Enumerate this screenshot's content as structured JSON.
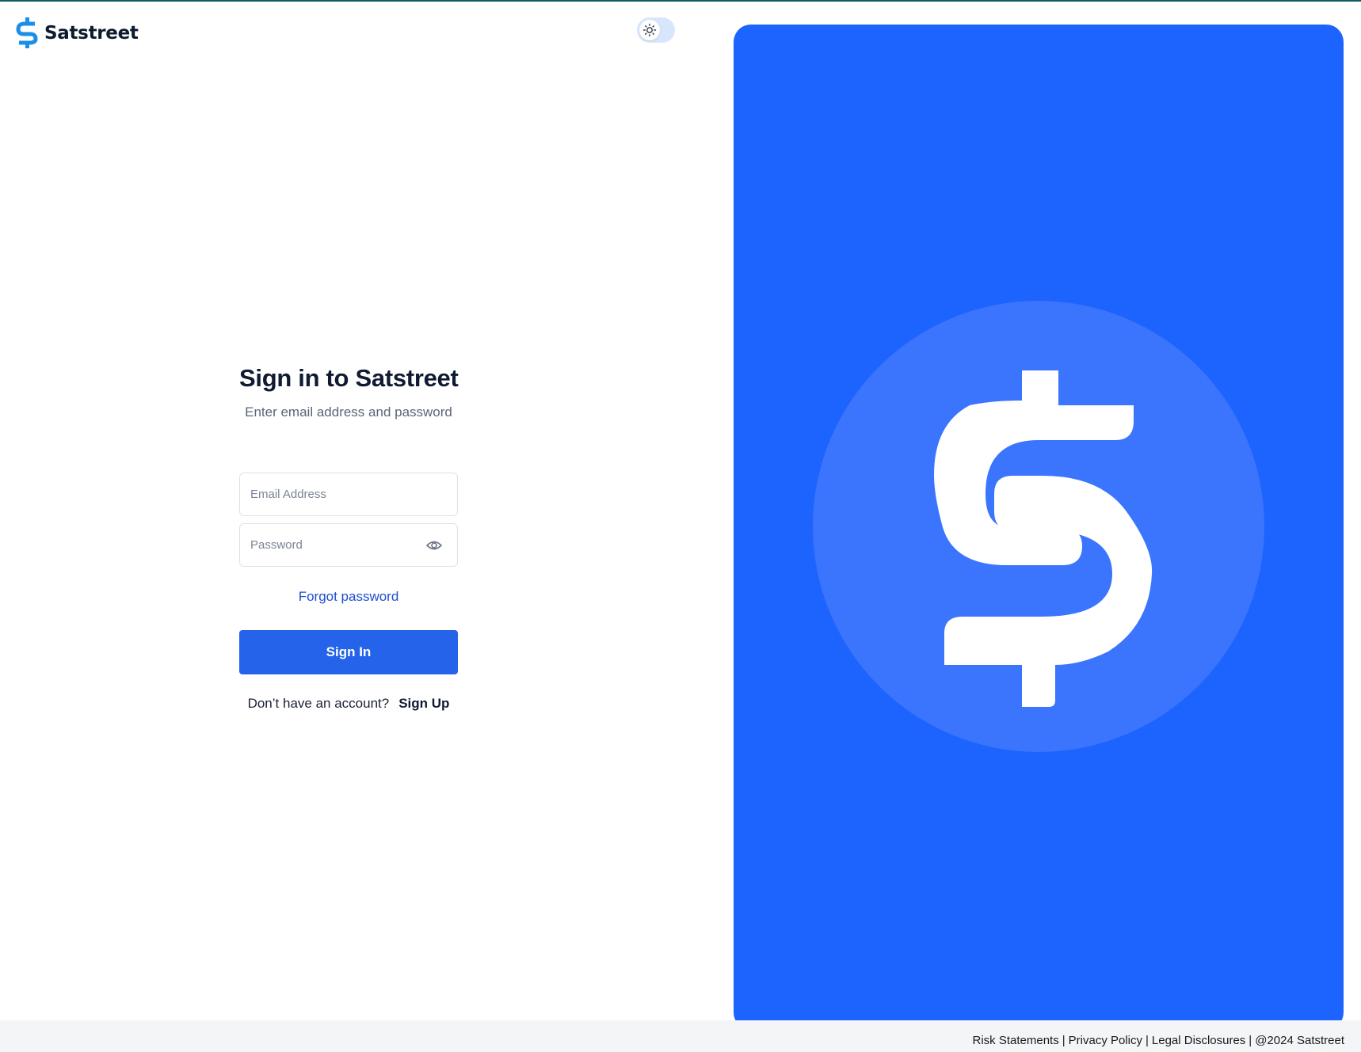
{
  "brand": {
    "name": "Satstreet",
    "color": "#0d1b2e",
    "logo_color": "#1a8fe8"
  },
  "theme_toggle": {
    "state": "light",
    "icon": "sun-icon"
  },
  "signin": {
    "title": "Sign in to Satstreet",
    "subtitle": "Enter email address and password",
    "email_placeholder": "Email Address",
    "password_placeholder": "Password",
    "password_toggle_icon": "eye-icon",
    "forgot_label": "Forgot password",
    "button_label": "Sign In",
    "signup_prompt": "Don’t have an account?",
    "signup_link": "Sign Up"
  },
  "hero": {
    "background": "#1d64fe",
    "circle_color": "#3b75fe",
    "icon": "dollar-icon"
  },
  "footer": {
    "links": [
      "Risk Statements",
      "Privacy Policy",
      "Legal Disclosures"
    ],
    "copyright": "@2024 Satstreet"
  },
  "colors": {
    "accent": "#2563eb",
    "link": "#1f4fd1",
    "heading": "#101b33"
  }
}
